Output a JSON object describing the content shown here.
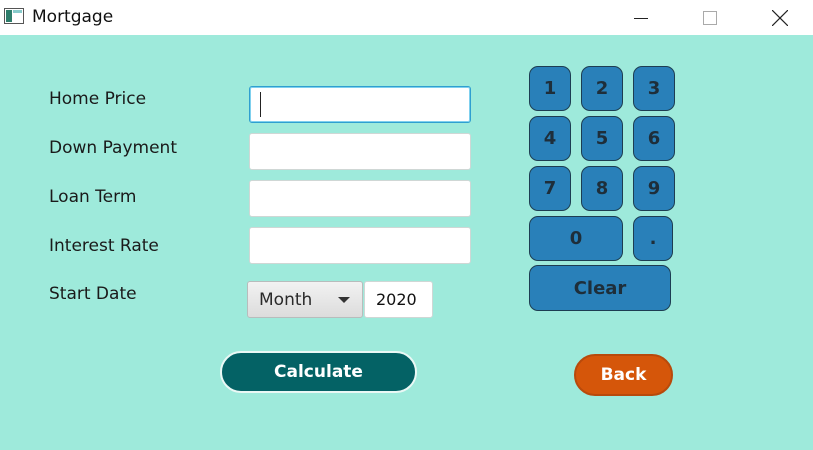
{
  "window": {
    "title": "Mortgage"
  },
  "form": {
    "home_price_label": "Home Price",
    "down_payment_label": "Down Payment",
    "loan_term_label": "Loan Term",
    "interest_rate_label": "Interest Rate",
    "start_date_label": "Start Date",
    "home_price_value": "",
    "down_payment_value": "",
    "loan_term_value": "",
    "interest_rate_value": "",
    "month_selected": "Month",
    "year_value": "2020"
  },
  "keypad": {
    "k1": "1",
    "k2": "2",
    "k3": "3",
    "k4": "4",
    "k5": "5",
    "k6": "6",
    "k7": "7",
    "k8": "8",
    "k9": "9",
    "k0": "0",
    "kdot": ".",
    "clear": "Clear"
  },
  "actions": {
    "calculate": "Calculate",
    "back": "Back"
  },
  "colors": {
    "background": "#9eeadb",
    "keypad": "#2980b9",
    "calculate": "#046265",
    "back": "#d5560a"
  }
}
